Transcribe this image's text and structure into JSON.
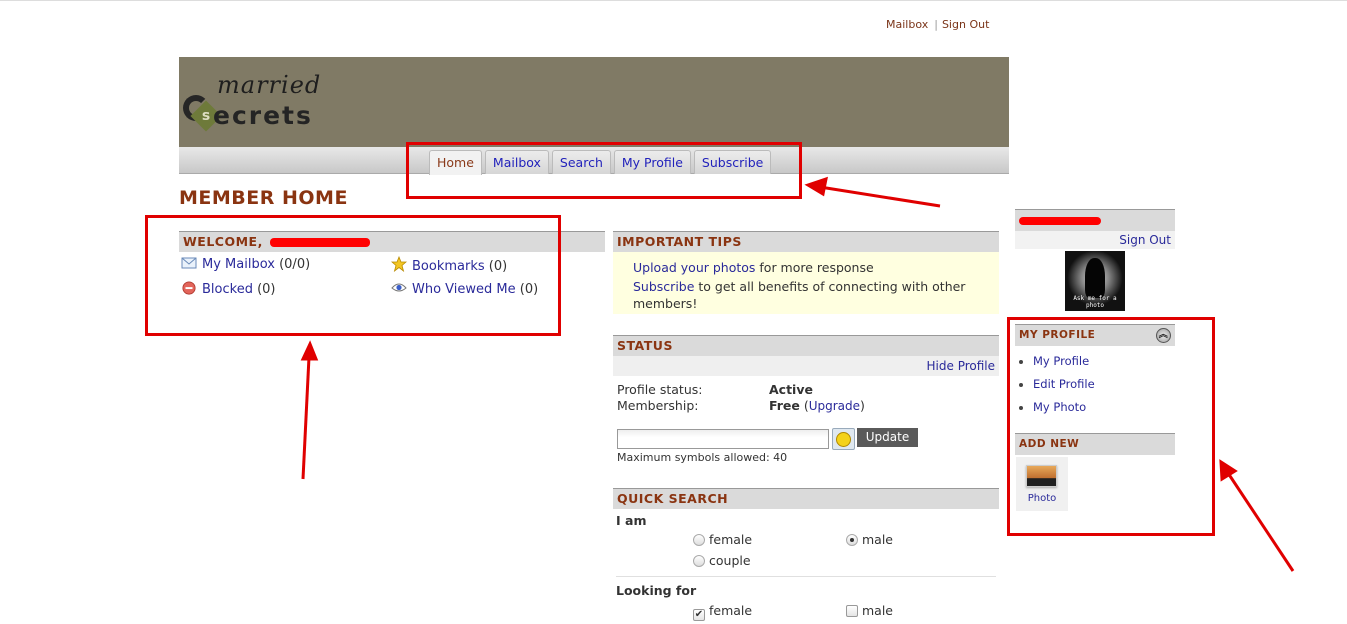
{
  "top_links": {
    "mailbox": "Mailbox",
    "separator": "|",
    "sign_out": "Sign Out"
  },
  "logo": {
    "line1": "married",
    "line2": "ecrets",
    "badge": "s"
  },
  "nav": {
    "tabs": [
      {
        "label": "Home",
        "active": true
      },
      {
        "label": "Mailbox",
        "active": false
      },
      {
        "label": "Search",
        "active": false
      },
      {
        "label": "My Profile",
        "active": false
      },
      {
        "label": "Subscribe",
        "active": false
      }
    ]
  },
  "page_title": "MEMBER HOME",
  "welcome": {
    "title": "WELCOME,",
    "items": [
      {
        "icon": "envelope-icon",
        "label": "My Mailbox",
        "count": "(0/0)"
      },
      {
        "icon": "star-icon",
        "label": "Bookmarks",
        "count": "(0)"
      },
      {
        "icon": "blocked-icon",
        "label": "Blocked",
        "count": "(0)"
      },
      {
        "icon": "eye-icon",
        "label": "Who Viewed Me",
        "count": "(0)"
      }
    ]
  },
  "tips": {
    "title": "IMPORTANT TIPS",
    "line1_link": "Upload your photos",
    "line1_text": " for more response",
    "line2_link": "Subscribe",
    "line2_text": " to get all benefits of connecting with other members!"
  },
  "status": {
    "title": "STATUS",
    "hide_profile": "Hide Profile",
    "profile_status_label": "Profile status:",
    "profile_status_value": "Active",
    "membership_label": "Membership:",
    "membership_value": "Free",
    "upgrade_open": " (",
    "upgrade_link": "Upgrade",
    "upgrade_close": ")",
    "input_value": "",
    "update_button": "Update",
    "max_symbols": "Maximum symbols allowed: 40"
  },
  "quick_search": {
    "title": "QUICK SEARCH",
    "i_am_label": "I am",
    "i_am_options": [
      {
        "label": "female",
        "selected": false
      },
      {
        "label": "male",
        "selected": true
      },
      {
        "label": "couple",
        "selected": false
      }
    ],
    "looking_for_label": "Looking for",
    "looking_for_options": [
      {
        "label": "female",
        "checked": true
      },
      {
        "label": "male",
        "checked": false
      }
    ]
  },
  "sidebar": {
    "sign_out": "Sign Out",
    "avatar_caption": "Ask me for a photo",
    "my_profile_title": "MY PROFILE",
    "my_profile_links": [
      "My Profile",
      "Edit Profile",
      "My Photo"
    ],
    "add_new_title": "ADD NEW",
    "add_new_items": [
      {
        "label": "Photo",
        "icon": "photo-icon"
      }
    ]
  },
  "annotation": {
    "color": "#e00000"
  }
}
